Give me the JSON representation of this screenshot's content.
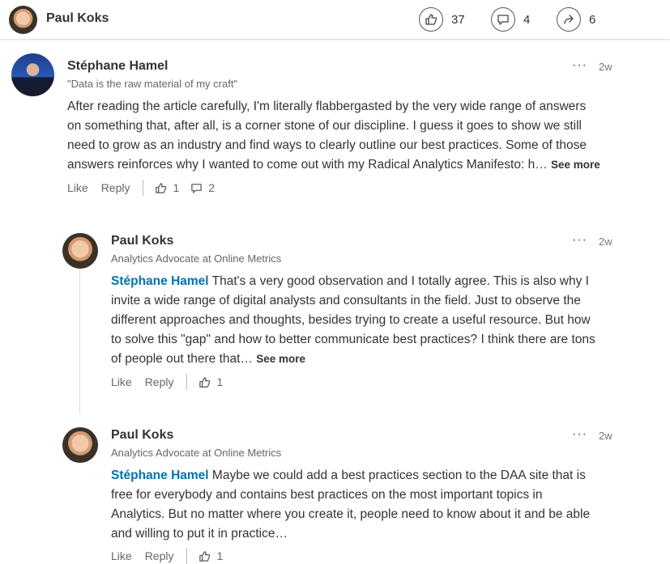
{
  "header": {
    "author": "Paul Koks",
    "likes": "37",
    "comments": "4",
    "shares": "6"
  },
  "comments": [
    {
      "author": "Stéphane Hamel",
      "headline": "\"Data is the raw material of my craft\"",
      "time": "2w",
      "mention": "",
      "lines": [
        "After reading the article carefully, I'm literally flabbergasted by the very wide range of answers",
        "on something that, after all, is a corner stone of our discipline. I guess it goes to show we still",
        "need to grow as an industry and find ways to clearly outline our best practices. Some of those",
        "answers reinforces why I wanted to come out with my Radical Analytics Manifesto: h…"
      ],
      "see_more": "See more",
      "like_label": "Like",
      "reply_label": "Reply",
      "like_count": "1",
      "reply_count": "2"
    },
    {
      "author": "Paul Koks",
      "headline": "Analytics Advocate at Online Metrics",
      "time": "2w",
      "mention": "Stéphane Hamel",
      "lines": [
        " That's a very good observation and I totally agree. This is also why I",
        "invite a wide range of digital analysts and consultants in the field. Just to observe the",
        "different approaches and thoughts, besides trying to create a useful resource. But how",
        "to solve this \"gap\" and how to better communicate best practices? I think there are tons",
        "of people out there that…"
      ],
      "see_more": "See more",
      "like_label": "Like",
      "reply_label": "Reply",
      "like_count": "1"
    },
    {
      "author": "Paul Koks",
      "headline": "Analytics Advocate at Online Metrics",
      "time": "2w",
      "mention": "Stéphane Hamel",
      "lines": [
        " Maybe we could add a best practices section to the DAA site that is",
        "free for everybody and contains best practices on the most important topics in",
        "Analytics. But no matter where you create it, people need to know about it and be able",
        "and willing to put it in practice…"
      ],
      "like_label": "Like",
      "reply_label": "Reply",
      "like_count": "1"
    }
  ],
  "colors": {
    "mention": "#0073b1",
    "text": "#333333",
    "muted": "#666666"
  }
}
